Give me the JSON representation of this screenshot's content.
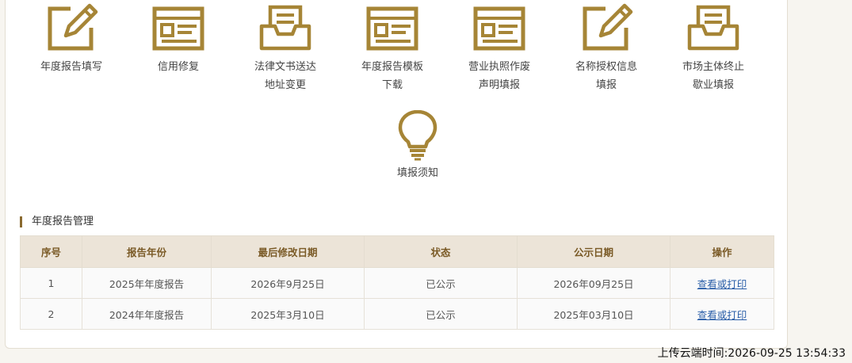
{
  "icons": [
    {
      "icon": "pencil-icon",
      "label": "年度报告填写"
    },
    {
      "icon": "form-window-icon",
      "label": "信用修复"
    },
    {
      "icon": "document-tray-icon",
      "label": "法律文书送达\n地址变更"
    },
    {
      "icon": "form-window-icon",
      "label": "年度报告模板\n下载"
    },
    {
      "icon": "form-window-icon",
      "label": "营业执照作废\n声明填报"
    },
    {
      "icon": "pencil-icon",
      "label": "名称授权信息\n填报"
    },
    {
      "icon": "document-tray-icon",
      "label": "市场主体终止\n歇业填报"
    },
    {
      "icon": "lightbulb-icon",
      "label": "填报须知"
    }
  ],
  "section": {
    "title": "年度报告管理"
  },
  "table": {
    "headers": [
      "序号",
      "报告年份",
      "最后修改日期",
      "状态",
      "公示日期",
      "操作"
    ],
    "rows": [
      [
        "1",
        "2025年年度报告",
        "2026年9月25日",
        "已公示",
        "2026年09月25日",
        "查看或打印"
      ],
      [
        "2",
        "2024年年度报告",
        "2025年3月10日",
        "已公示",
        "2025年03月10日",
        "查看或打印"
      ]
    ]
  },
  "footer": {
    "upload_time": "上传云端时间:2026-09-25 13:54:33"
  },
  "colors": {
    "accent": "#a68536",
    "header_bg": "#ece4d8",
    "link": "#2a5ea8"
  }
}
